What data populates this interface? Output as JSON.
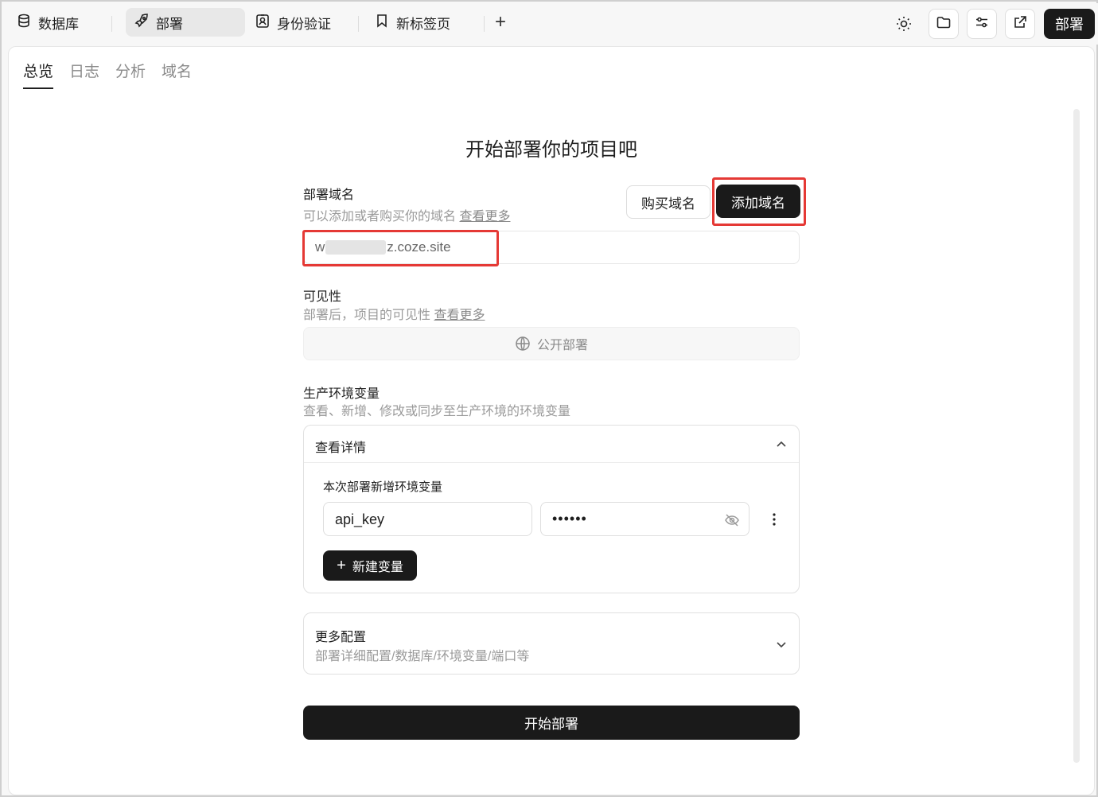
{
  "topbar": {
    "tabs": [
      {
        "label": "数据库",
        "icon": "database-icon"
      },
      {
        "label": "部署",
        "icon": "rocket-icon",
        "active": true
      },
      {
        "label": "身份验证",
        "icon": "id-badge-icon"
      },
      {
        "label": "新标签页",
        "icon": "bookmark-icon"
      }
    ],
    "deploy_label": "部署"
  },
  "subtabs": [
    "总览",
    "日志",
    "分析",
    "域名"
  ],
  "main": {
    "title": "开始部署你的项目吧",
    "domain": {
      "label": "部署域名",
      "hint": "可以添加或者购买你的域名",
      "hint_link": "查看更多",
      "buy_label": "购买域名",
      "add_label": "添加域名",
      "value_prefix": "w",
      "value_suffix": "z.coze.site"
    },
    "visibility": {
      "label": "可见性",
      "hint": "部署后，项目的可见性",
      "hint_link": "查看更多",
      "value": "公开部署"
    },
    "env": {
      "label": "生产环境变量",
      "hint": "查看、新增、修改或同步至生产环境的环境变量",
      "details_title": "查看详情",
      "new_section_title": "本次部署新增环境变量",
      "key": "api_key",
      "value_masked": "••••••",
      "add_var_label": "新建变量"
    },
    "more": {
      "title": "更多配置",
      "hint": "部署详细配置/数据库/环境变量/端口等"
    },
    "start_label": "开始部署"
  },
  "colors": {
    "accent_dark": "#1a1a1a",
    "highlight_red": "#e53935"
  }
}
